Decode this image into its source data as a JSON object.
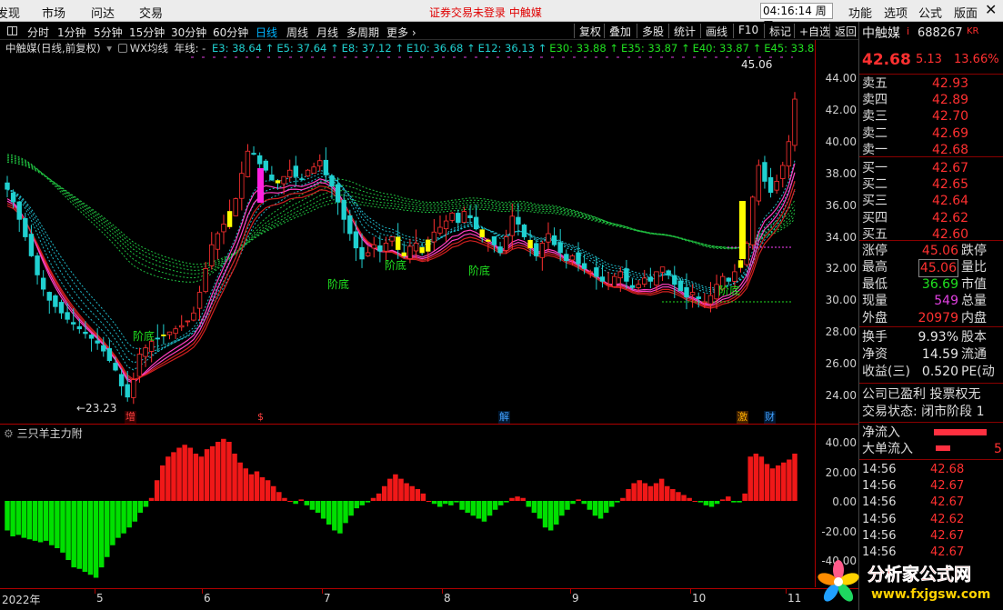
{
  "menu": {
    "left_items": [
      "发现",
      "市场",
      "问达",
      "交易"
    ],
    "alert": "证券交易未登录  中触媒",
    "clock": "04:16:14 周五",
    "right_items": [
      "功能",
      "选项",
      "公式",
      "版面"
    ],
    "close": "✕"
  },
  "periods": [
    "分时",
    "1分钟",
    "5分钟",
    "15分钟",
    "30分钟",
    "60分钟",
    "日线",
    "周线",
    "月线",
    "多周期",
    "更多 ›"
  ],
  "active_period": "日线",
  "toolbar_buttons": [
    "复权",
    "叠加",
    "多股",
    "统计",
    "画线",
    "F10",
    "标记",
    "+自选",
    "返回"
  ],
  "legend": {
    "stock": "中触媒(日线,前复权)",
    "formula": "WX均线",
    "mode": "年线: -",
    "items": [
      {
        "text": "E3: 38.64",
        "color": "#20d0d0"
      },
      {
        "text": "E5: 37.64",
        "color": "#20d0d0"
      },
      {
        "text": "E8: 37.12",
        "color": "#20d0d0"
      },
      {
        "text": "E10: 36.68",
        "color": "#20d0d0"
      },
      {
        "text": "E12: 36.13",
        "color": "#20d0d0"
      },
      {
        "text": "E30: 33.88",
        "color": "#20e020"
      },
      {
        "text": "E35: 33.87",
        "color": "#20e020"
      },
      {
        "text": "E40: 33.87",
        "color": "#20e020"
      },
      {
        "text": "E45: 33.88",
        "color": "#20e020"
      }
    ]
  },
  "price_axis": [
    "44.00",
    "42.00",
    "40.00",
    "38.00",
    "36.00",
    "34.00",
    "32.00",
    "30.00",
    "28.00",
    "26.00",
    "24.00"
  ],
  "sub_axis": [
    "40.00",
    "20.00",
    "0.00",
    "-20.00",
    "-40.00"
  ],
  "sub_title": "三只羊主力附",
  "annotations": {
    "high": "45.06",
    "low": "←23.23",
    "bottom_label": "阶底"
  },
  "events": [
    {
      "text": "增",
      "color": "#ff4040",
      "bg": "#300000"
    },
    {
      "text": "$",
      "color": "#ff4040",
      "bg": "#000"
    },
    {
      "text": "解",
      "color": "#40a0ff",
      "bg": "#001830"
    },
    {
      "text": "激",
      "color": "#ffb000",
      "bg": "#402000"
    },
    {
      "text": "财",
      "color": "#40a0ff",
      "bg": "#001830"
    }
  ],
  "date_labels": [
    "2022年",
    "5",
    "6",
    "7",
    "8",
    "9",
    "10",
    "11"
  ],
  "panel": {
    "name": "中触媒",
    "name_suffix": "i",
    "code": "688267",
    "code_suffix": "KR",
    "price": "42.68",
    "change": "5.13",
    "pct": "13.66%",
    "orderbook": [
      {
        "label": "卖五",
        "price": "42.93"
      },
      {
        "label": "卖四",
        "price": "42.89"
      },
      {
        "label": "卖三",
        "price": "42.70"
      },
      {
        "label": "卖二",
        "price": "42.69"
      },
      {
        "label": "卖一",
        "price": "42.68"
      },
      {
        "label": "买一",
        "price": "42.67"
      },
      {
        "label": "买二",
        "price": "42.65"
      },
      {
        "label": "买三",
        "price": "42.64"
      },
      {
        "label": "买四",
        "price": "42.62"
      },
      {
        "label": "买五",
        "price": "42.60"
      }
    ],
    "stats": [
      {
        "label": "涨停",
        "value": "45.06",
        "right": "跌停",
        "color": "#ff3030"
      },
      {
        "label": "最高",
        "value": "45.06",
        "right": "量比",
        "color": "#ff3030"
      },
      {
        "label": "最低",
        "value": "36.69",
        "right": "市值",
        "color": "#20e020"
      },
      {
        "label": "现量",
        "value": "549",
        "right": "总量",
        "color": "#e040e0"
      },
      {
        "label": "外盘",
        "value": "20979",
        "right": "内盘",
        "color": "#ff3030"
      }
    ],
    "fin": [
      {
        "label": "换手",
        "value": "9.93%",
        "right": "股本"
      },
      {
        "label": "净资",
        "value": "14.59",
        "right": "流通"
      },
      {
        "label": "收益(三)",
        "value": "0.520",
        "right": "PE(动"
      }
    ],
    "notes": [
      "公司已盈利 投票权无",
      "交易状态: 闭市阶段 1"
    ],
    "flows": [
      {
        "label": "净流入",
        "value": ""
      },
      {
        "label": "大单流入",
        "value": "5"
      }
    ],
    "ticks": [
      {
        "time": "14:56",
        "price": "42.68"
      },
      {
        "time": "14:56",
        "price": "42.67"
      },
      {
        "time": "14:56",
        "price": "42.67"
      },
      {
        "time": "14:56",
        "price": "42.62"
      },
      {
        "time": "14:56",
        "price": "42.67"
      },
      {
        "time": "14:56",
        "price": "42.67"
      }
    ]
  },
  "colors": {
    "up": "#ff3030",
    "down": "#20d0d0",
    "ma_short": "#20d0d0",
    "ma_long": "#20e020",
    "highlight": "#ffff00"
  },
  "watermark": {
    "title": "分析家公式网",
    "url": "www.fxjgsw.com"
  },
  "chart_data": {
    "type": "candlestick",
    "price_ylim": [
      22.5,
      45.5
    ],
    "close_path": [
      37.0,
      36.2,
      35.1,
      34.0,
      32.8,
      31.6,
      30.7,
      30.0,
      29.6,
      29.2,
      28.8,
      28.5,
      28.2,
      27.9,
      27.6,
      27.3,
      26.8,
      26.2,
      25.6,
      24.6,
      23.9,
      25.0,
      26.6,
      27.0,
      27.4,
      27.6,
      27.8,
      28.0,
      28.2,
      28.4,
      28.7,
      29.2,
      30.5,
      32.0,
      33.5,
      34.2,
      34.8,
      35.6,
      36.4,
      38.0,
      39.4,
      39.2,
      38.6,
      38.2,
      37.6,
      37.4,
      37.8,
      38.2,
      37.8,
      37.6,
      38.2,
      38.4,
      38.8,
      37.9,
      37.2,
      36.2,
      35.1,
      34.2,
      33.3,
      32.6,
      33.0,
      33.5,
      33.1,
      33.6,
      34.0,
      33.2,
      32.8,
      33.4,
      33.6,
      33.0,
      33.8,
      34.3,
      34.6,
      35.0,
      35.5,
      34.9,
      35.6,
      35.2,
      34.5,
      34.0,
      33.8,
      33.5,
      33.0,
      34.0,
      35.3,
      34.8,
      34.0,
      33.3,
      32.8,
      33.6,
      34.2,
      33.5,
      33.0,
      32.5,
      32.8,
      32.3,
      32.0,
      31.8,
      31.5,
      31.2,
      31.0,
      31.5,
      31.8,
      31.2,
      30.8,
      31.0,
      31.4,
      31.2,
      31.8,
      32.1,
      31.6,
      31.0,
      30.6,
      30.2,
      30.5,
      30.1,
      29.9,
      30.3,
      31.0,
      31.5,
      31.2,
      31.8,
      32.5,
      33.6,
      36.5,
      38.5,
      37.5,
      36.8,
      37.5,
      38.5,
      40.0,
      42.68
    ],
    "main_flow_ylim": [
      -55,
      50
    ],
    "main_flow": [
      -20,
      -24,
      -23,
      -25,
      -26,
      -27,
      -28,
      -27,
      -30,
      -32,
      -35,
      -40,
      -45,
      -46,
      -48,
      -50,
      -52,
      -45,
      -38,
      -30,
      -25,
      -22,
      -18,
      -14,
      -8,
      -4,
      2,
      14,
      24,
      30,
      33,
      36,
      38,
      36,
      32,
      30,
      35,
      37,
      40,
      42,
      40,
      32,
      26,
      22,
      18,
      20,
      16,
      14,
      10,
      6,
      2,
      0,
      -2,
      1,
      -3,
      -6,
      -8,
      -12,
      -16,
      -20,
      -22,
      -15,
      -10,
      -5,
      -3,
      -1,
      2,
      5,
      10,
      15,
      18,
      15,
      12,
      10,
      8,
      5,
      0,
      -2,
      -4,
      -2,
      -3,
      -1,
      -6,
      -8,
      -10,
      -12,
      -14,
      -10,
      -6,
      -3,
      -1,
      2,
      3,
      2,
      -4,
      -8,
      -12,
      -18,
      -20,
      -16,
      -10,
      -6,
      -2,
      1,
      -2,
      -6,
      -10,
      -12,
      -8,
      -4,
      -1,
      2,
      8,
      12,
      14,
      12,
      10,
      12,
      15,
      10,
      8,
      6,
      4,
      2,
      0,
      -1,
      -3,
      -4,
      -2,
      1,
      3,
      -1,
      -1,
      5,
      30,
      32,
      30,
      25,
      22,
      24,
      26,
      28,
      32
    ]
  }
}
